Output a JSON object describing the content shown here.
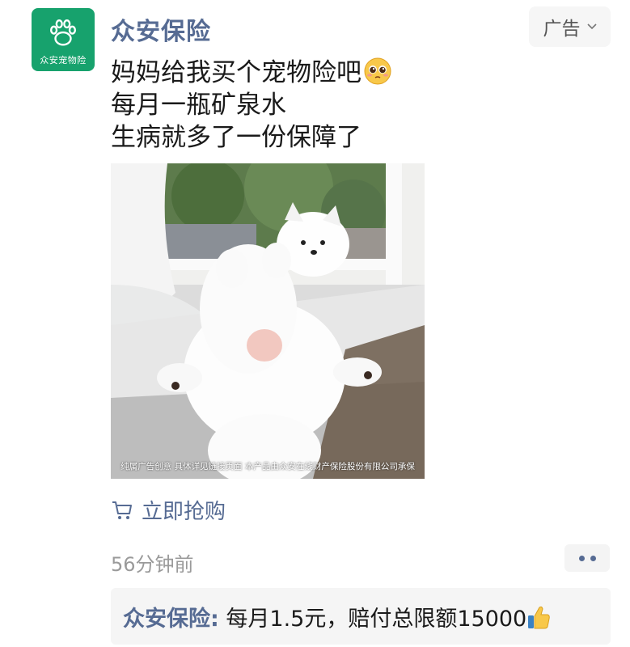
{
  "header": {
    "avatar_label": "众安宠物险",
    "avatar_icon": "paw-icon",
    "account_name": "众安保险",
    "ad_tag": "广告"
  },
  "post": {
    "caption_lines": [
      "妈妈给我买个宠物险吧",
      "每月一瓶矿泉水",
      "生病就多了一份保障了"
    ],
    "caption_emoji": "pleading-face-emoji",
    "image_disclaimer": "纯属广告创意 具体详见链接页面 本产品由众安在线财产保险股份有限公司承保",
    "buy_label": "立即抢购",
    "time": "56分钟前"
  },
  "comment": {
    "author": "众安保险",
    "separator": ":",
    "text": " 每月1.5元，赔付总限额15000",
    "emoji": "thumbs-up-emoji"
  },
  "colors": {
    "brand_green": "#17a26d",
    "link_blue": "#566b93",
    "muted_gray": "#9a9a9a"
  }
}
